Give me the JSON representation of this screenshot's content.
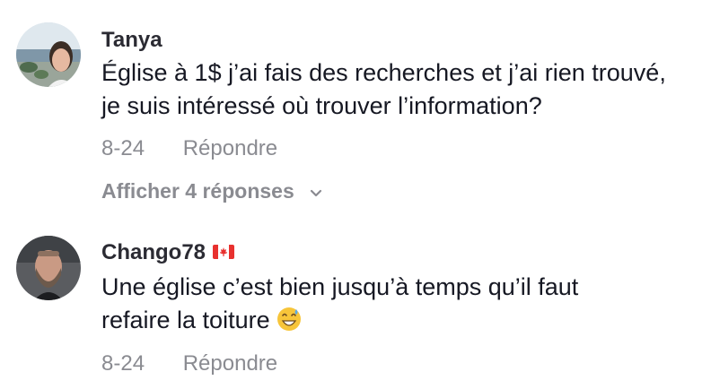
{
  "comments": [
    {
      "username": "Tanya",
      "text_line1": "Église à 1$ j’ai fais des recherches et j’ai rien trouvé,",
      "text_line2": "je suis intéressé où trouver l’information?",
      "date": "8-24",
      "reply_label": "Répondre",
      "view_replies_label": "Afficher 4 réponses",
      "avatar_icon": "profile-photo-beach"
    },
    {
      "username": "Chango78",
      "flag_icon": "canada-flag-icon",
      "text_line1": "Une église c’est bien jusqu’à temps qu’il faut",
      "text_line2": "refaire la toiture",
      "emoji_icon": "grinning-sweat-emoji",
      "date": "8-24",
      "reply_label": "Répondre",
      "avatar_icon": "profile-photo-bearded-man"
    }
  ],
  "colors": {
    "text": "#161823",
    "muted": "#8a8b91",
    "flag_red": "#e8312f"
  }
}
